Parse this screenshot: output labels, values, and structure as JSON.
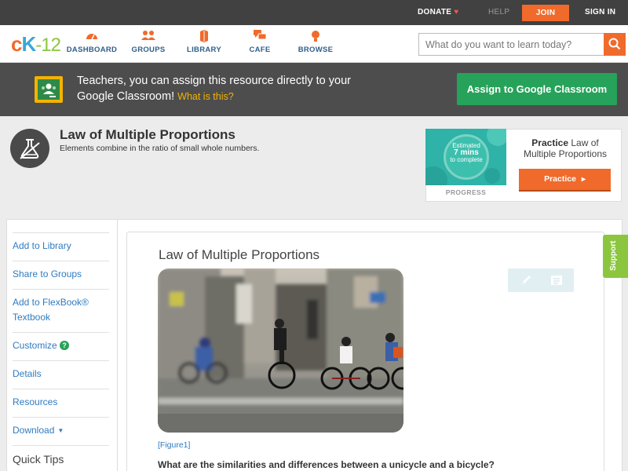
{
  "topbar": {
    "donate": "DONATE",
    "help": "HELP",
    "join": "JOIN",
    "signin": "SIGN IN"
  },
  "nav": {
    "logo": {
      "c": "c",
      "k": "K",
      "n": "-12"
    },
    "items": [
      {
        "label": "DASHBOARD",
        "icon": "dashboard-icon"
      },
      {
        "label": "GROUPS",
        "icon": "groups-icon"
      },
      {
        "label": "LIBRARY",
        "icon": "library-icon"
      },
      {
        "label": "CAFE",
        "icon": "cafe-icon"
      },
      {
        "label": "BROWSE",
        "icon": "browse-icon"
      }
    ],
    "search_placeholder": "What do you want to learn today?"
  },
  "banner": {
    "text": "Teachers, you can assign this resource directly to your Google Classroom!",
    "link": "What is this?",
    "button": "Assign to Google Classroom"
  },
  "concept": {
    "title": "Law of Multiple Proportions",
    "subtitle": "Elements combine in the ratio of small whole numbers."
  },
  "practice": {
    "estimate_line1": "Estimated",
    "estimate_line2": "7 mins",
    "estimate_line3": "to complete",
    "progress_label": "PROGRESS",
    "label_bold": "Practice",
    "label_rest": "Law of Multiple Proportions",
    "button": "Practice"
  },
  "sidebar": {
    "items": [
      "Add to Library",
      "Share to Groups",
      "Add to FlexBook® Textbook",
      "Customize",
      "Details",
      "Resources",
      "Download"
    ],
    "quick_tips": "Quick Tips"
  },
  "content": {
    "title": "Law of Multiple Proportions",
    "figure_label": "[Figure1]",
    "question": "What are the similarities and differences between a unicycle and a bicycle?"
  },
  "support": "Support",
  "colors": {
    "accent": "#f06a2c",
    "link": "#2f7bbf",
    "green": "#27a25a",
    "support": "#8cc63f"
  }
}
